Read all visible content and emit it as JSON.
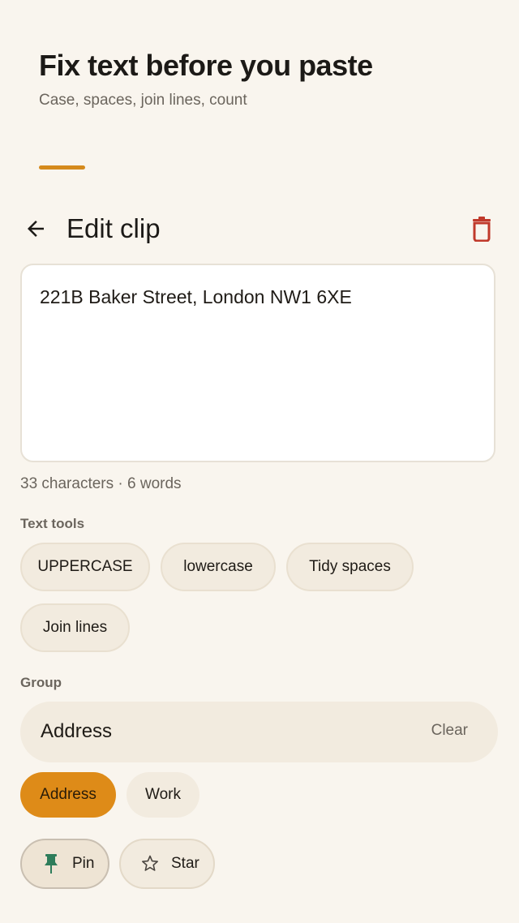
{
  "header": {
    "title": "Fix text before you paste",
    "subtitle": "Case, spaces, join lines, count"
  },
  "topbar": {
    "back_icon": "arrow-left-icon",
    "title": "Edit clip",
    "delete_icon": "trash-icon"
  },
  "editor": {
    "value": "221B Baker Street, London NW1 6XE"
  },
  "stats": "33 characters · 6 words",
  "text_tools": {
    "label": "Text tools",
    "items": [
      "UPPERCASE",
      "lowercase",
      "Tidy spaces",
      "Join lines"
    ]
  },
  "group": {
    "label": "Group",
    "value": "Address",
    "clear_label": "Clear",
    "options": [
      {
        "label": "Address",
        "selected": true
      },
      {
        "label": "Work",
        "selected": false
      }
    ]
  },
  "toggles": {
    "pin": {
      "label": "Pin",
      "icon": "pin-icon",
      "active": true
    },
    "star": {
      "label": "Star",
      "icon": "star-outline-icon",
      "active": false
    }
  },
  "colors": {
    "accent": "#de8b18",
    "background": "#f9f5ee",
    "delete": "#c0392b",
    "pin_icon": "#2e7d5b"
  }
}
